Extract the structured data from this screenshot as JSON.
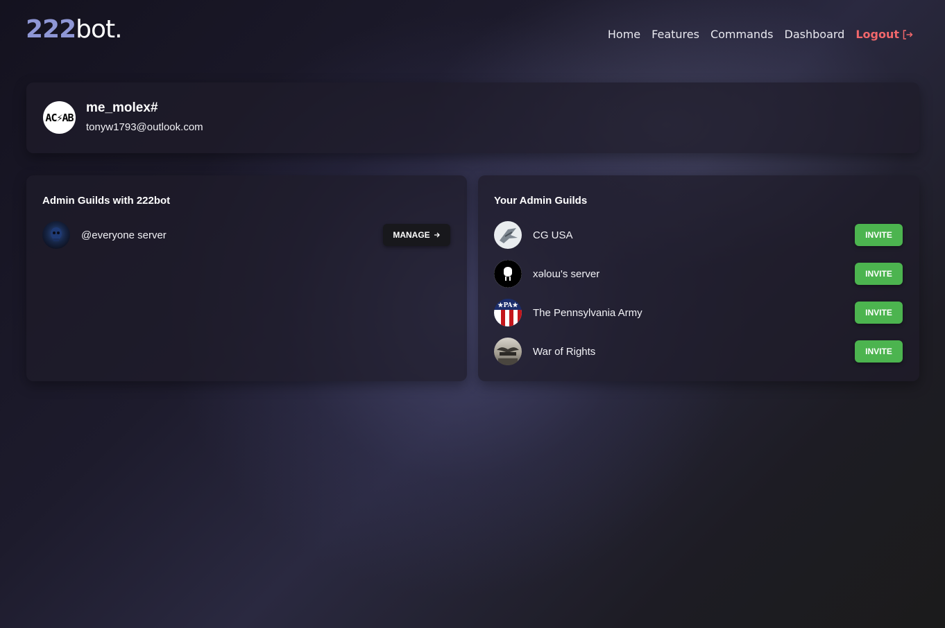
{
  "brand": {
    "logo_number": "222",
    "logo_text": "bot."
  },
  "nav": {
    "items": [
      "Home",
      "Features",
      "Commands",
      "Dashboard"
    ],
    "logout": "Logout"
  },
  "profile": {
    "avatar_text": "AC⚡AB",
    "username": "me_molex#",
    "email": "tonyw1793@outlook.com"
  },
  "bot_guilds": {
    "title": "Admin Guilds with 222bot",
    "items": [
      {
        "name": "@everyone server",
        "action": "MANAGE"
      }
    ]
  },
  "admin_guilds": {
    "title": "Your Admin Guilds",
    "items": [
      {
        "name": "CG USA",
        "action": "INVITE",
        "icon": "jet-icon"
      },
      {
        "name": "xǝloɯ's server",
        "action": "INVITE",
        "icon": "github-icon"
      },
      {
        "name": "The Pennsylvania Army",
        "action": "INVITE",
        "icon": "flag-icon",
        "icon_text": "★PA★"
      },
      {
        "name": "War of Rights",
        "action": "INVITE",
        "icon": "eagle-icon"
      }
    ]
  },
  "colors": {
    "accent_logo": "#8f97d6",
    "logout": "#f1676b",
    "invite": "#4cb44f"
  }
}
